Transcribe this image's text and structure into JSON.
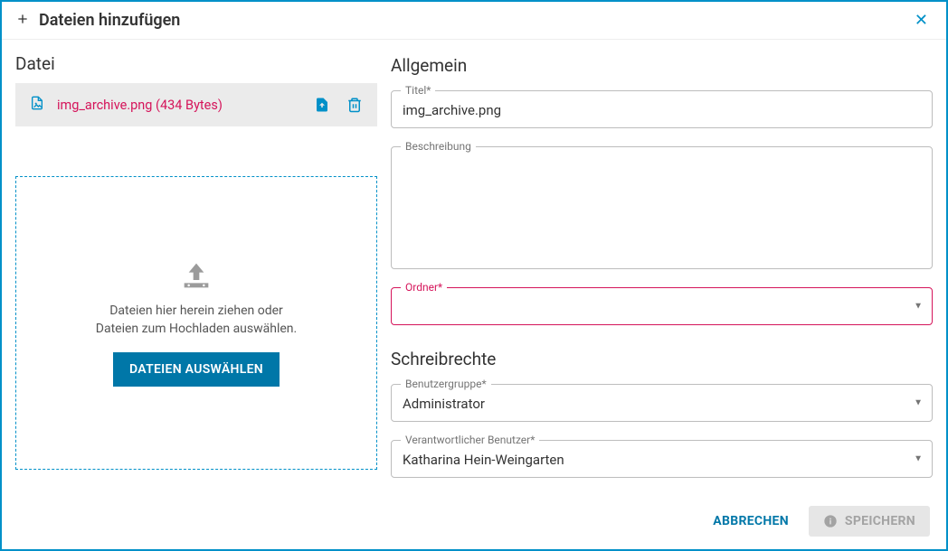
{
  "header": {
    "title": "Dateien hinzufügen"
  },
  "left": {
    "heading": "Datei",
    "file": {
      "name": "img_archive.png (434 Bytes)"
    },
    "dropzone": {
      "line1": "Dateien hier herein ziehen oder",
      "line2": "Dateien zum Hochladen auswählen.",
      "button": "DATEIEN AUSWÄHLEN"
    }
  },
  "right": {
    "section1": "Allgemein",
    "title_label": "Titel*",
    "title_value": "img_archive.png",
    "desc_label": "Beschreibung",
    "desc_value": "",
    "folder_label": "Ordner*",
    "folder_value": "",
    "section2": "Schreibrechte",
    "group_label": "Benutzergruppe*",
    "group_value": "Administrator",
    "user_label": "Verantwortlicher Benutzer*",
    "user_value": "Katharina Hein-Weingarten"
  },
  "footer": {
    "cancel": "ABBRECHEN",
    "save": "SPEICHERN"
  }
}
